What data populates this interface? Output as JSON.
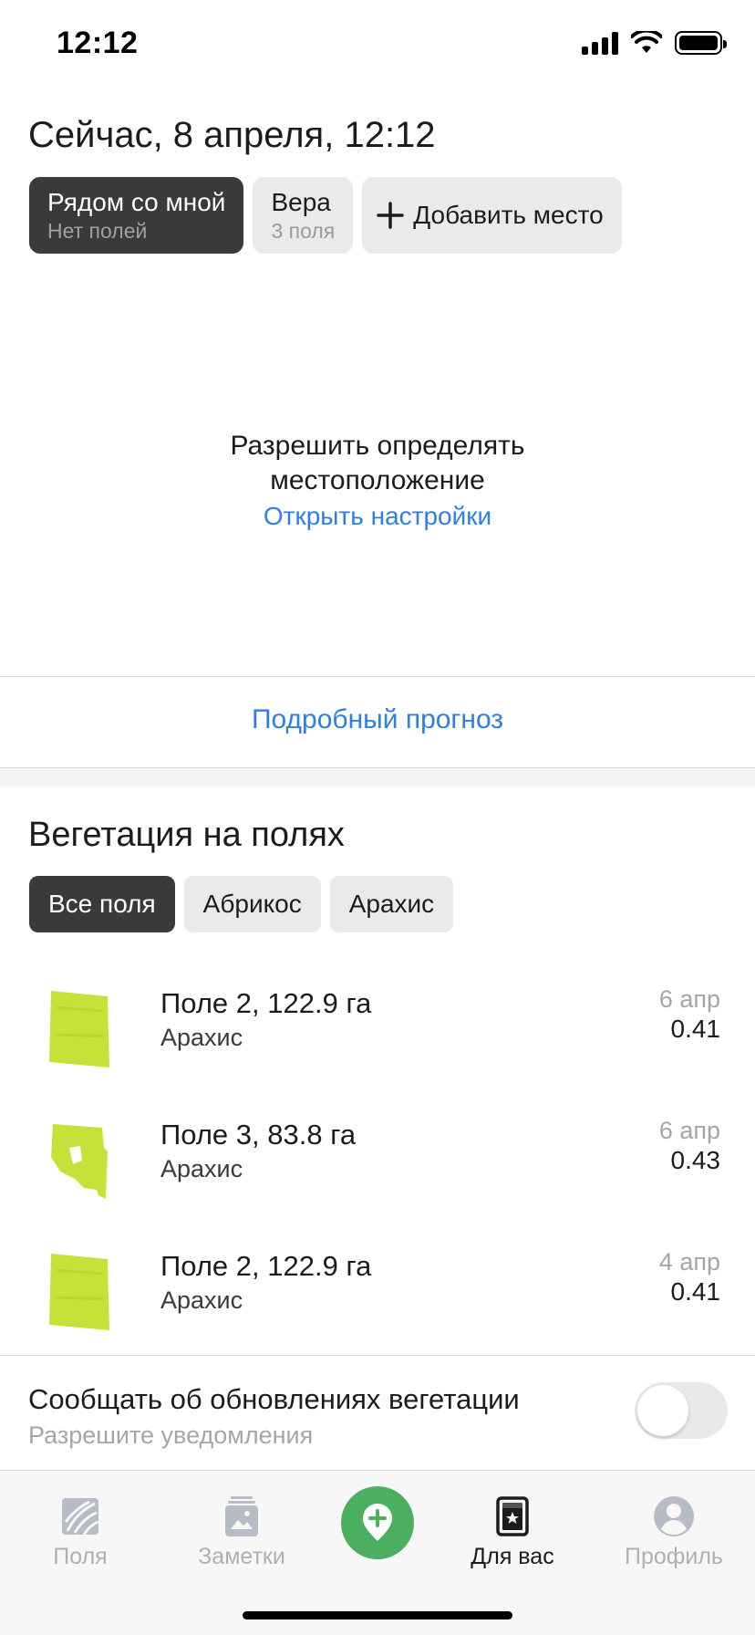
{
  "status_bar": {
    "time": "12:12"
  },
  "header": {
    "title": "Сейчас, 8 апреля, 12:12"
  },
  "places": [
    {
      "title": "Рядом со мной",
      "subtitle": "Нет полей",
      "active": true
    },
    {
      "title": "Вера",
      "subtitle": "3 поля",
      "active": false
    }
  ],
  "add_place_label": "Добавить место",
  "location_prompt": {
    "message": "Разрешить определять местоположение",
    "settings_link": "Открыть настройки"
  },
  "forecast_link": "Подробный прогноз",
  "vegetation": {
    "title": "Вегетация на полях",
    "filters": [
      "Все поля",
      "Абрикос",
      "Арахис"
    ],
    "active_filter": "Все поля",
    "fields": [
      {
        "name": "Поле 2, 122.9 га",
        "crop": "Арахис",
        "date": "6 апр",
        "value": "0.41"
      },
      {
        "name": "Поле 3, 83.8 га",
        "crop": "Арахис",
        "date": "6 апр",
        "value": "0.43"
      },
      {
        "name": "Поле 2, 122.9 га",
        "crop": "Арахис",
        "date": "4 апр",
        "value": "0.41"
      }
    ]
  },
  "notifications": {
    "title": "Сообщать об обновлениях вегетации",
    "subtitle": "Разрешите уведомления",
    "enabled": false
  },
  "tab_bar": {
    "tabs": [
      {
        "label": "Поля",
        "icon": "fields-icon",
        "active": false
      },
      {
        "label": "Заметки",
        "icon": "notes-icon",
        "active": false
      },
      {
        "label": "Для вас",
        "icon": "for-you-icon",
        "active": true
      },
      {
        "label": "Профиль",
        "icon": "profile-icon",
        "active": false
      }
    ],
    "center_icon": "add-note-location-icon"
  },
  "colors": {
    "accent_blue": "#2f7ee8",
    "chip_active": "#3a3a3c",
    "chip_inactive": "#e9eaec",
    "fab_green": "#4caf5f",
    "field_green": "#c8e13a"
  }
}
